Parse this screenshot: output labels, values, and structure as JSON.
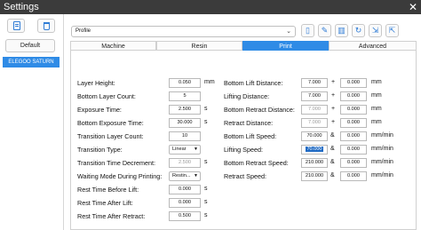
{
  "window": {
    "title": "Settings",
    "close_glyph": "✕"
  },
  "left_panel": {
    "new_icon": "doc-icon",
    "delete_icon": "trash-icon",
    "default_label": "Default",
    "printer": "ELEGOO SATURN"
  },
  "toolbar": {
    "profile_value": "Profile",
    "buttons": [
      "new-icon",
      "edit-icon",
      "delete-icon",
      "refresh-icon",
      "import-icon",
      "export-icon"
    ]
  },
  "tabs": [
    "Machine",
    "Resin",
    "Print",
    "Advanced"
  ],
  "active_tab": "Print",
  "left_fields": {
    "layer_height": {
      "label": "Layer Height:",
      "value": "0.050",
      "unit": "mm"
    },
    "bottom_layer_count": {
      "label": "Bottom Layer Count:",
      "value": "5",
      "unit": ""
    },
    "exposure_time": {
      "label": "Exposure Time:",
      "value": "2.500",
      "unit": "s"
    },
    "bottom_exposure_time": {
      "label": "Bottom Exposure Time:",
      "value": "30.000",
      "unit": "s"
    },
    "transition_layer_count": {
      "label": "Transition Layer Count:",
      "value": "10",
      "unit": ""
    },
    "transition_type": {
      "label": "Transition Type:",
      "value": "Linear",
      "unit": ""
    },
    "transition_time_decrement": {
      "label": "Transition Time Decrement:",
      "value": "2.500",
      "unit": "s"
    },
    "waiting_mode": {
      "label": "Waiting Mode During Printing:",
      "value": "Restin...",
      "unit": ""
    },
    "rest_before_lift": {
      "label": "Rest Time Before Lift:",
      "value": "0.000",
      "unit": "s"
    },
    "rest_after_lift": {
      "label": "Rest Time After Lift:",
      "value": "0.000",
      "unit": "s"
    },
    "rest_after_retract": {
      "label": "Rest Time After Retract:",
      "value": "0.500",
      "unit": "s"
    }
  },
  "right_fields": {
    "bottom_lift_distance": {
      "label": "Bottom Lift Distance:",
      "value1": "7.000",
      "op": "+",
      "value2": "0.000",
      "unit": "mm"
    },
    "lifting_distance": {
      "label": "Lifting Distance:",
      "value1": "7.000",
      "op": "+",
      "value2": "0.000",
      "unit": "mm"
    },
    "bottom_retract_distance": {
      "label": "Bottom Retract Distance:",
      "value1": "7.000",
      "op": "+",
      "value2": "0.000",
      "unit": "mm"
    },
    "retract_distance": {
      "label": "Retract Distance:",
      "value1": "7.000",
      "op": "+",
      "value2": "0.000",
      "unit": "mm"
    },
    "bottom_lift_speed": {
      "label": "Bottom Lift Speed:",
      "value1": "70.000",
      "op": "&",
      "value2": "0.000",
      "unit": "mm/min"
    },
    "lifting_speed": {
      "label": "Lifting Speed:",
      "value1": "70.000",
      "op": "&",
      "value2": "0.000",
      "unit": "mm/min"
    },
    "bottom_retract_speed": {
      "label": "Bottom Retract Speed:",
      "value1": "210.000",
      "op": "&",
      "value2": "0.000",
      "unit": "mm/min"
    },
    "retract_speed": {
      "label": "Retract Speed:",
      "value1": "210.000",
      "op": "&",
      "value2": "0.000",
      "unit": "mm/min"
    }
  }
}
